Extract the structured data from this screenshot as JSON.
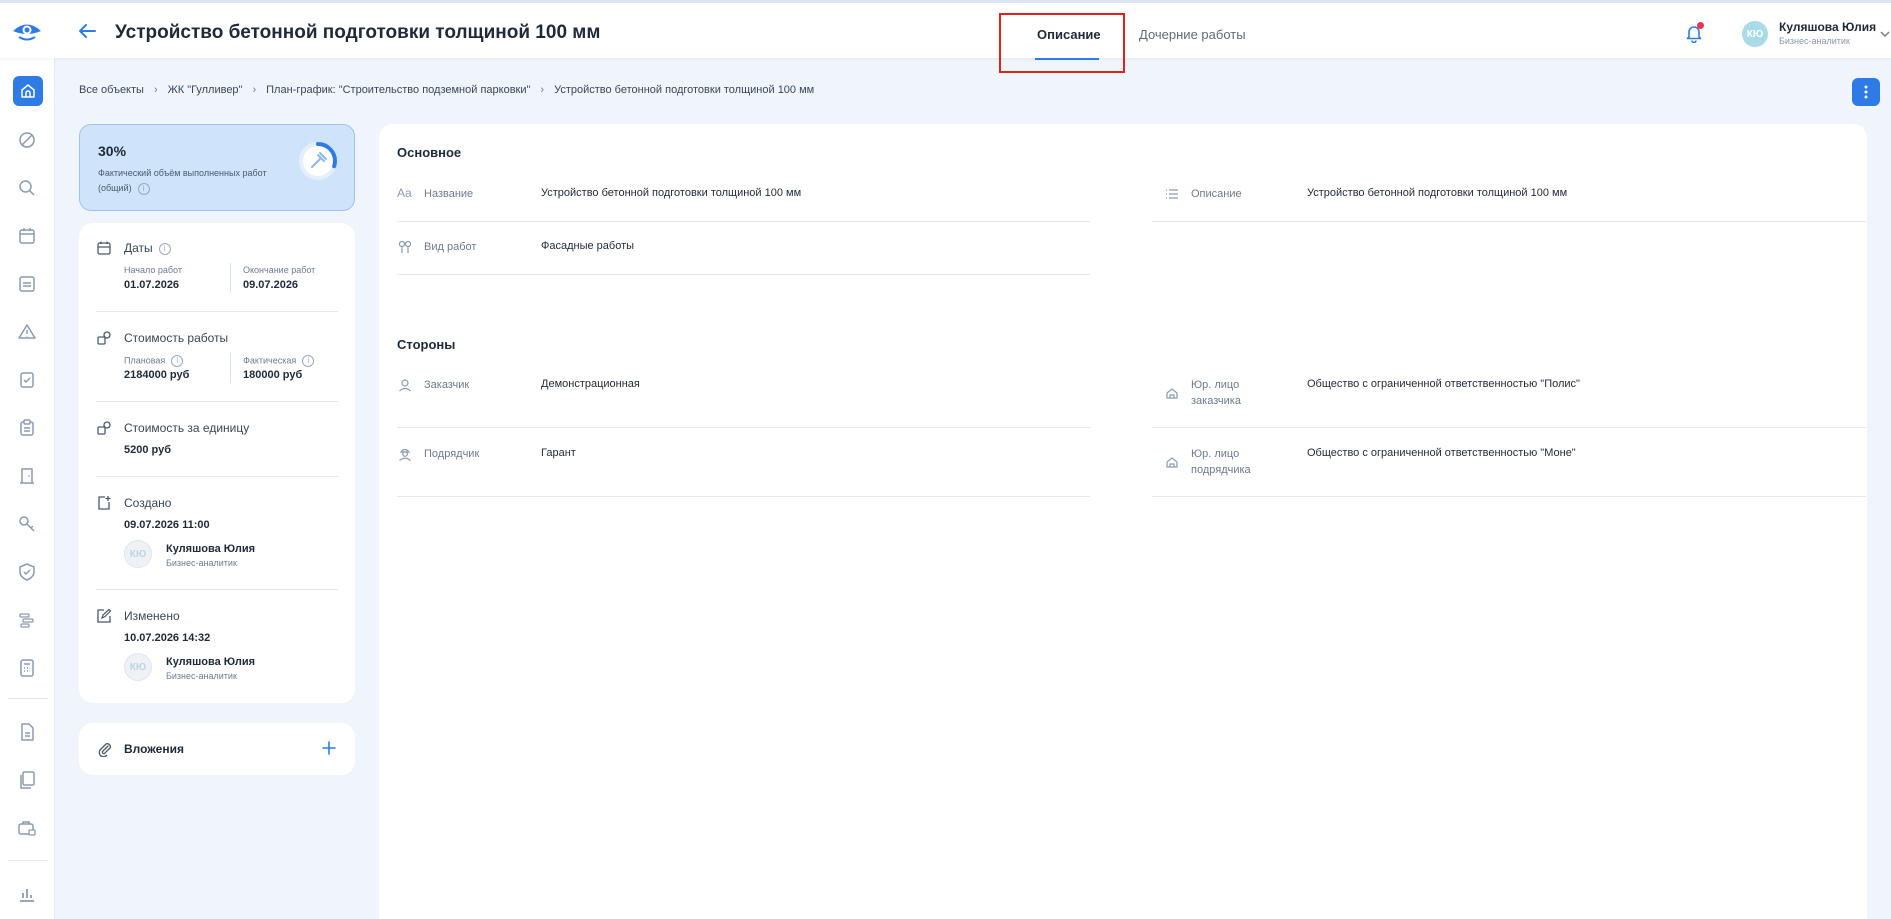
{
  "header": {
    "title": "Устройство бетонной подготовки толщиной 100 мм",
    "tabs": [
      {
        "label": "Описание",
        "active": true
      },
      {
        "label": "Дочерние работы",
        "active": false
      }
    ],
    "user": {
      "initials": "КЮ",
      "name": "Куляшова Юлия",
      "role": "Бизнес-аналитик"
    },
    "notification_indicator": true
  },
  "sidebar": {
    "icons": [
      "home-icon",
      "forbidden-icon",
      "search-icon",
      "calendar-icon",
      "document-icon",
      "warning-icon",
      "checklist-icon",
      "clipboard-icon",
      "door-icon",
      "key-icon",
      "shield-icon",
      "gantt-icon",
      "calculator-icon",
      "file-icon",
      "files-icon",
      "case-lock-icon",
      "chart-icon"
    ]
  },
  "breadcrumb": [
    "Все объекты",
    "ЖК \"Гулливер\"",
    "План-график: \"Строительство подземной парковки\"",
    "Устройство бетонной подготовки толщиной 100 мм"
  ],
  "progress": {
    "value": 0.3,
    "percent_label": "30%",
    "label": "Фактический объём выполненных работ (общий)"
  },
  "info": {
    "dates": {
      "title": "Даты",
      "start_label": "Начало работ",
      "start_value": "01.07.2026",
      "end_label": "Окончание работ",
      "end_value": "09.07.2026"
    },
    "cost": {
      "title": "Стоимость работы",
      "planned_label": "Плановая",
      "planned_value": "2184000 руб",
      "actual_label": "Фактическая",
      "actual_value": "180000 руб"
    },
    "unit_cost": {
      "title": "Стоимость за единицу",
      "value": "5200 руб"
    },
    "created": {
      "title": "Создано",
      "date": "09.07.2026 11:00",
      "initials": "КЮ",
      "name": "Куляшова Юлия",
      "role": "Бизнес-аналитик"
    },
    "modified": {
      "title": "Изменено",
      "date": "10.07.2026 14:32",
      "initials": "КЮ",
      "name": "Куляшова Юлия",
      "role": "Бизнес-аналитик"
    }
  },
  "attachments": {
    "label": "Вложения"
  },
  "main": {
    "basic": {
      "title": "Основное",
      "name_label": "Название",
      "name_value": "Устройство бетонной подготовки толщиной 100 мм",
      "desc_label": "Описание",
      "desc_value": "Устройство бетонной подготовки толщиной 100 мм",
      "type_label": "Вид работ",
      "type_value": "Фасадные работы"
    },
    "parties": {
      "title": "Стороны",
      "customer_label": "Заказчик",
      "customer_value": "Демонстрационная",
      "customer_legal_label": "Юр. лицо заказчика",
      "customer_legal_value": "Общество с ограниченной ответственностью \"Полис\"",
      "contractor_label": "Подрядчик",
      "contractor_value": "Гарант",
      "contractor_legal_label": "Юр. лицо подрядчика",
      "contractor_legal_value": "Общество с ограниченной ответственностью \"Моне\""
    }
  }
}
